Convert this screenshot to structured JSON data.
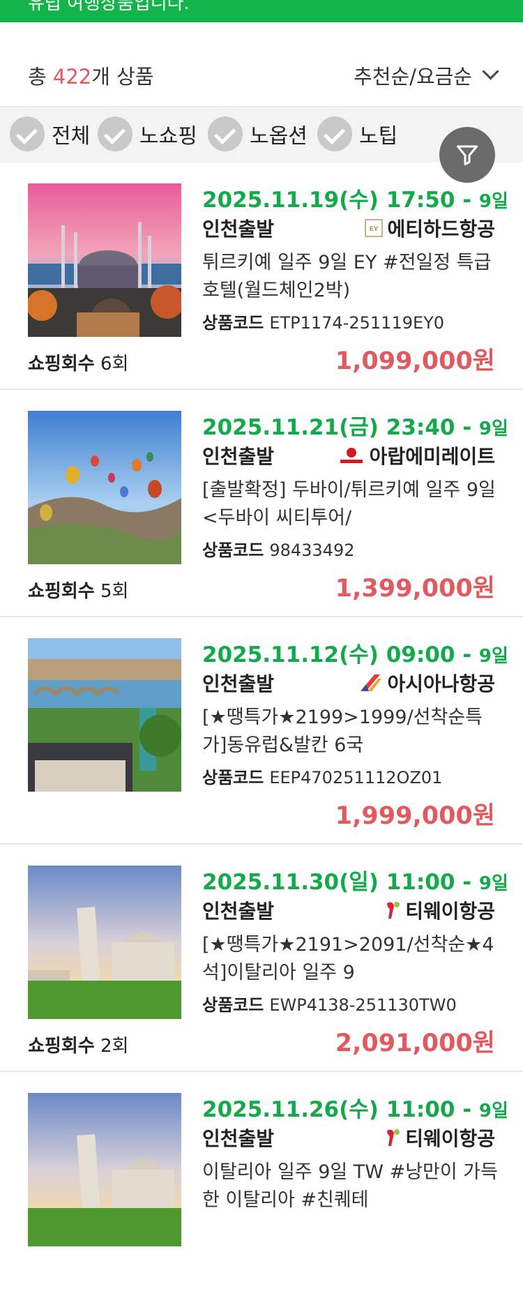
{
  "banner": {
    "text": "유럽 여행상품입니다."
  },
  "summary": {
    "prefix": "총 ",
    "count": "422",
    "suffix": "개 상품",
    "sort_label": "추천순/요금순"
  },
  "filters": [
    {
      "label": "전체"
    },
    {
      "label": "노쇼핑"
    },
    {
      "label": "노옵션"
    },
    {
      "label": "노팁"
    }
  ],
  "products": [
    {
      "date": "2025.11.19(수) 17:50 - ",
      "days": "9일",
      "depart": "인천출발",
      "airline": "에티하드항공",
      "airline_logo": "etihad-logo",
      "name": "튀르키예 일주 9일 EY #전일정 특급호텔(월드체인2박)",
      "code_label": "상품코드",
      "code": "ETP1174-251119EY0",
      "shop_label": "쇼핑회수",
      "shop_count": "6회",
      "price": "1,099,000원",
      "image": "istanbul-mosque"
    },
    {
      "date": "2025.11.21(금) 23:40 - ",
      "days": "9일",
      "depart": "인천출발",
      "airline": "아랍에미레이트",
      "airline_logo": "emirates-logo",
      "name": "[출발확정] 두바이/튀르키예 일주 9일 <두바이 씨티투어/",
      "code_label": "상품코드",
      "code": "98433492",
      "shop_label": "쇼핑회수",
      "shop_count": "5회",
      "price": "1,399,000원",
      "image": "cappadocia-balloons"
    },
    {
      "date": "2025.11.12(수) 09:00 - ",
      "days": "9일",
      "depart": "인천출발",
      "airline": "아시아나항공",
      "airline_logo": "asiana-logo",
      "name": "[★땡특가★2199>1999/선착순특가]동유럽&발칸 6국",
      "code_label": "상품코드",
      "code": "EEP470251112OZ01",
      "shop_label": "",
      "shop_count": "",
      "price": "1,999,000원",
      "image": "prague-bridges"
    },
    {
      "date": "2025.11.30(일) 11:00 - ",
      "days": "9일",
      "depart": "인천출발",
      "airline": "티웨이항공",
      "airline_logo": "tway-logo",
      "name": "[★땡특가★2191>2091/선착순★4석]이탈리아 일주 9",
      "code_label": "상품코드",
      "code": "EWP4138-251130TW0",
      "shop_label": "쇼핑회수",
      "shop_count": "2회",
      "price": "2,091,000원",
      "image": "pisa-tower"
    },
    {
      "date": "2025.11.26(수) 11:00 - ",
      "days": "9일",
      "depart": "인천출발",
      "airline": "티웨이항공",
      "airline_logo": "tway-logo",
      "name": "이탈리아 일주 9일 TW #낭만이 가득한 이탈리아 #친퀘테",
      "code_label": "",
      "code": "",
      "shop_label": "",
      "shop_count": "",
      "price": "",
      "image": "pisa-tower"
    }
  ]
}
